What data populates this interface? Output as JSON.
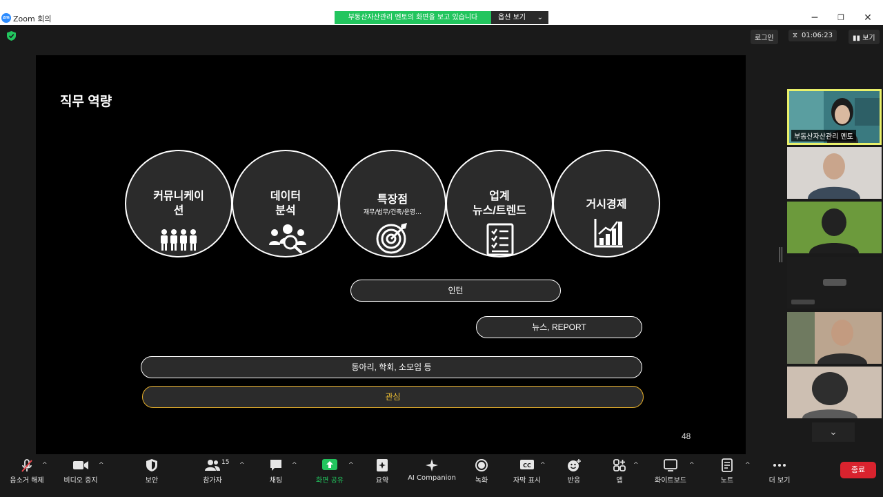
{
  "window": {
    "title": "Zoom 회의",
    "app_icon": "zm",
    "controls": {
      "minimize": "─",
      "maximize": "❐",
      "close": "✕"
    }
  },
  "banner": {
    "viewing_text": "부동산자산관리 멘토의 화면을 보고 있습니다",
    "options_label": "옵션 보기",
    "chevron": "⌄"
  },
  "topbar": {
    "login_label": "로그인",
    "timer_icon": "⧖",
    "timer_value": "01:06:23",
    "view_label": "보기",
    "security_color": "#22c55e"
  },
  "slide": {
    "title": "직무 역량",
    "page_number": "48",
    "circles": [
      {
        "label_line1": "커뮤니케이",
        "label_line2": "션",
        "icon": "people-icon"
      },
      {
        "label_line1": "데이터",
        "label_line2": "분석",
        "icon": "analysis-icon"
      },
      {
        "label_line1": "특장점",
        "sub": "재무/법무/건축/운영…",
        "icon": "target-icon"
      },
      {
        "label_line1": "업계",
        "label_line2": "뉴스/트렌드",
        "icon": "checklist-icon"
      },
      {
        "label_line1": "거시경제",
        "icon": "growth-chart-icon"
      }
    ],
    "pills": {
      "intern": "인턴",
      "news": "뉴스, REPORT",
      "clubs": "동아리, 학회, 소모임 등",
      "interest": "관심"
    },
    "accent_color": "#e8b02a"
  },
  "participants_panel": {
    "active_speaker": "부동산자산관리 멘토",
    "scroll_down": "⌄"
  },
  "toolbar": {
    "mute": "음소거 해제",
    "video": "비디오 중지",
    "security": "보안",
    "participants": "참가자",
    "participant_count": "15",
    "chat": "채팅",
    "share": "화면 공유",
    "summary": "요약",
    "ai_companion": "AI Companion",
    "record": "녹화",
    "captions": "자막 표시",
    "reactions": "반응",
    "apps": "앱",
    "whiteboard": "화이트보드",
    "notes": "노트",
    "more": "더 보기",
    "end": "종료",
    "caret": "^",
    "share_color": "#22c55e",
    "end_color": "#d9232e"
  }
}
